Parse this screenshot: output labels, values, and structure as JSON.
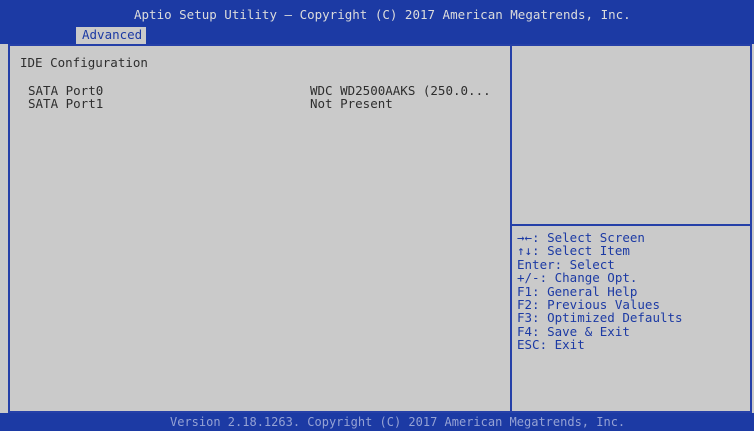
{
  "window": {
    "title": "Aptio Setup Utility – Copyright (C) 2017 American Megatrends, Inc."
  },
  "tabs": [
    {
      "label": "Advanced",
      "active": true
    }
  ],
  "main": {
    "heading": "IDE Configuration",
    "items": [
      {
        "label": "SATA Port0",
        "value": "WDC WD2500AAKS (250.0..."
      },
      {
        "label": "SATA Port1",
        "value": "Not Present"
      }
    ]
  },
  "help": {
    "keys": [
      "→←: Select Screen",
      "↑↓: Select Item",
      "Enter: Select",
      "+/-: Change Opt.",
      "F1: General Help",
      "F2: Previous Values",
      "F3: Optimized Defaults",
      "F4: Save & Exit",
      "ESC: Exit"
    ]
  },
  "footer": {
    "version": "Version 2.18.1263. Copyright (C) 2017 American Megatrends, Inc."
  },
  "colors": {
    "bar_blue": "#1c3aa4",
    "panel_gray": "#cacaca",
    "frame_line": "#2540a8",
    "item_text": "#2e2e2e",
    "help_text": "#1c3aa4",
    "title_text": "#dcdcdc",
    "footer_text": "#95a2d4"
  }
}
